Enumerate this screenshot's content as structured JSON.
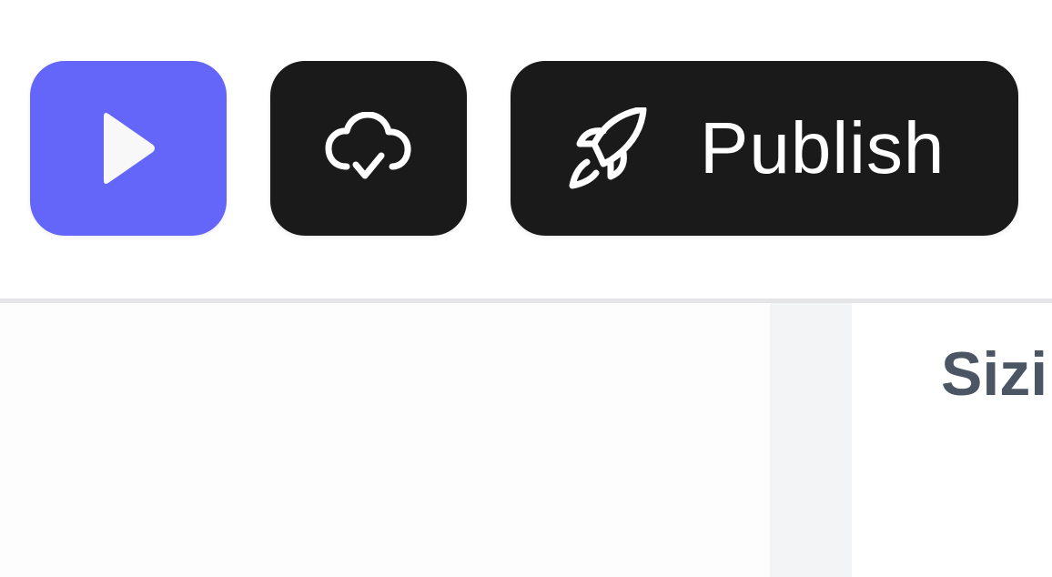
{
  "colors": {
    "play_button_bg": "#6366f9",
    "dark_button_bg": "#1a1a1a",
    "icon_fg": "#ffffff",
    "divider": "#e5e5e7",
    "canvas_bg": "#fdfdfd",
    "gutter_bg": "#f3f4f6",
    "heading_text": "#4b5563"
  },
  "toolbar": {
    "play_button": {
      "icon": "play-icon"
    },
    "save_status_button": {
      "icon": "cloud-check-icon"
    },
    "publish_button": {
      "icon": "rocket-icon",
      "label": "Publish"
    }
  },
  "inspector": {
    "heading": "Sizi"
  }
}
